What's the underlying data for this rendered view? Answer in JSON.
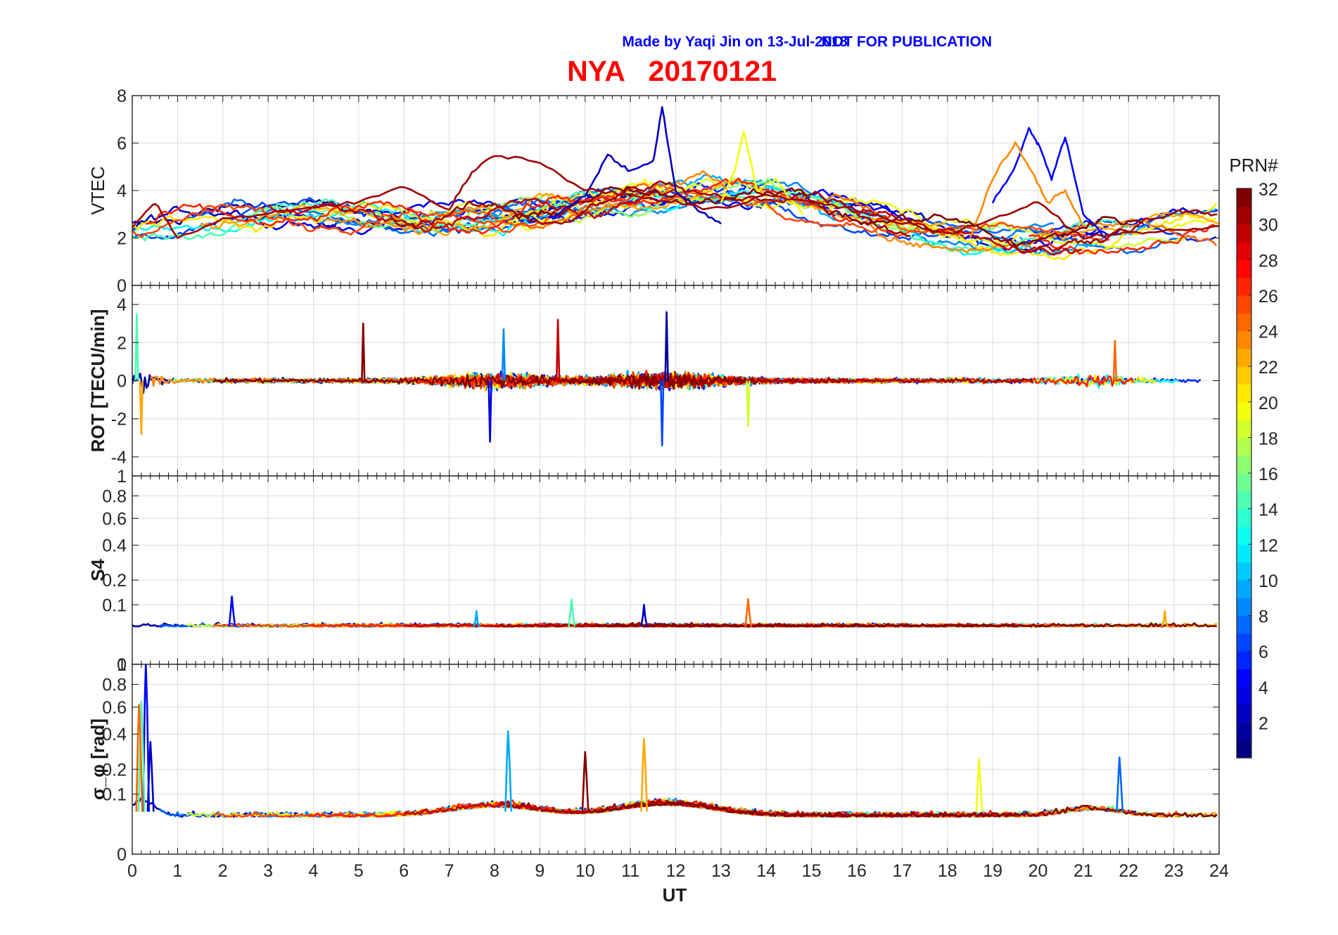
{
  "header": {
    "made_by": "Made by Yaqi Jin on 13-Jul-2018",
    "notice": "NOT FOR PUBLICATION",
    "title": "NYA   20170121",
    "blue": "#0000ff",
    "red": "#ff0000"
  },
  "chart_data": {
    "type": "line",
    "xlabel": "UT",
    "x_range": [
      0,
      24
    ],
    "x_ticks": [
      "0",
      "1",
      "2",
      "3",
      "4",
      "5",
      "6",
      "7",
      "8",
      "9",
      "10",
      "11",
      "12",
      "13",
      "14",
      "15",
      "16",
      "17",
      "18",
      "19",
      "20",
      "21",
      "22",
      "23",
      "24"
    ],
    "grid": true,
    "colorbar": {
      "label": "PRN#",
      "range": [
        1,
        32
      ],
      "colormap": "jet",
      "ticks": [
        "2",
        "4",
        "6",
        "8",
        "10",
        "12",
        "14",
        "16",
        "18",
        "20",
        "22",
        "24",
        "26",
        "28",
        "30",
        "32"
      ]
    },
    "panels": [
      {
        "id": "vtec",
        "ylabel": "VTEC",
        "ylim": [
          0,
          8
        ],
        "y_ticks": [
          "0",
          "2",
          "4",
          "6",
          "8"
        ],
        "description_values": {
          "typical_range": [
            1.5,
            5.5
          ],
          "peak_value": 7.5,
          "peak_time_ut": 11.7
        },
        "series_samples": [
          {
            "prn": 3,
            "x": [
              9.2,
              10.0,
              10.5,
              11.0,
              11.5,
              11.7,
              12.0,
              12.5,
              13.0
            ],
            "y": [
              2.8,
              3.8,
              5.5,
              4.8,
              5.2,
              7.5,
              4.0,
              3.2,
              2.6
            ]
          },
          {
            "prn": 5,
            "x": [
              19.0,
              19.5,
              19.8,
              20.0,
              20.3,
              20.6,
              21.0,
              21.5
            ],
            "y": [
              3.5,
              5.0,
              6.6,
              6.0,
              4.5,
              6.3,
              3.0,
              2.0
            ]
          },
          {
            "prn": 20,
            "x": [
              13.0,
              13.3,
              13.5,
              13.8,
              14.2,
              14.8
            ],
            "y": [
              3.5,
              4.8,
              6.5,
              4.0,
              4.5,
              3.0
            ]
          },
          {
            "prn": 24,
            "x": [
              18.5,
              19.0,
              19.5,
              19.8,
              20.2,
              20.6,
              21.0
            ],
            "y": [
              2.0,
              4.5,
              6.0,
              5.0,
              3.5,
              4.0,
              2.5
            ]
          },
          {
            "prn": 31,
            "x": [
              0.0,
              0.5,
              1.0,
              2.0,
              3.0,
              4.0,
              5.0,
              6.0,
              7.0,
              7.5,
              8.0,
              9.0,
              10.0,
              11.0,
              12.0,
              13.0,
              14.0,
              15.0,
              16.0,
              17.0,
              18.0,
              19.0,
              20.0,
              21.0,
              22.0,
              23.0,
              24.0
            ],
            "y": [
              2.5,
              3.5,
              2.0,
              2.8,
              3.0,
              3.3,
              3.5,
              4.2,
              3.2,
              4.8,
              5.5,
              5.2,
              4.0,
              3.8,
              3.5,
              3.2,
              3.8,
              3.5,
              3.2,
              2.6,
              2.2,
              2.8,
              3.5,
              2.0,
              2.2,
              2.3,
              2.5
            ]
          }
        ]
      },
      {
        "id": "rot",
        "ylabel": "ROT [TECU/min]",
        "ylim": [
          -5,
          5
        ],
        "y_ticks": [
          "-4",
          "-2",
          "0",
          "2",
          "4"
        ],
        "description_values": {
          "max": 3.6,
          "max_time_ut": 11.8,
          "min": -3.4,
          "min_time_ut": 11.7,
          "start_spike_max": 3.5,
          "start_spike_min": -2.8
        }
      },
      {
        "id": "s4",
        "ylabel": "S4",
        "ylim": [
          0,
          1
        ],
        "y_ticks": [
          "0",
          "0.1",
          "0.2",
          "0.4",
          "0.6",
          "0.8",
          "1"
        ],
        "description_values": {
          "baseline": 0.04,
          "max": 0.13,
          "max_time_ut": 2.2
        }
      },
      {
        "id": "sigma_phi",
        "ylabel": "σ_φ [rad]",
        "ylim": [
          0,
          1
        ],
        "y_ticks": [
          "0",
          "0.1",
          "0.2",
          "0.4",
          "0.6",
          "0.8",
          "1"
        ],
        "description_values": {
          "baseline": 0.05,
          "max": 1.0,
          "max_time_ut": 0.3,
          "secondary_peaks": [
            {
              "x": 8.3,
              "y": 0.42
            },
            {
              "x": 11.3,
              "y": 0.37
            },
            {
              "x": 10.0,
              "y": 0.29
            },
            {
              "x": 21.8,
              "y": 0.26
            },
            {
              "x": 18.7,
              "y": 0.25
            }
          ]
        }
      }
    ]
  }
}
